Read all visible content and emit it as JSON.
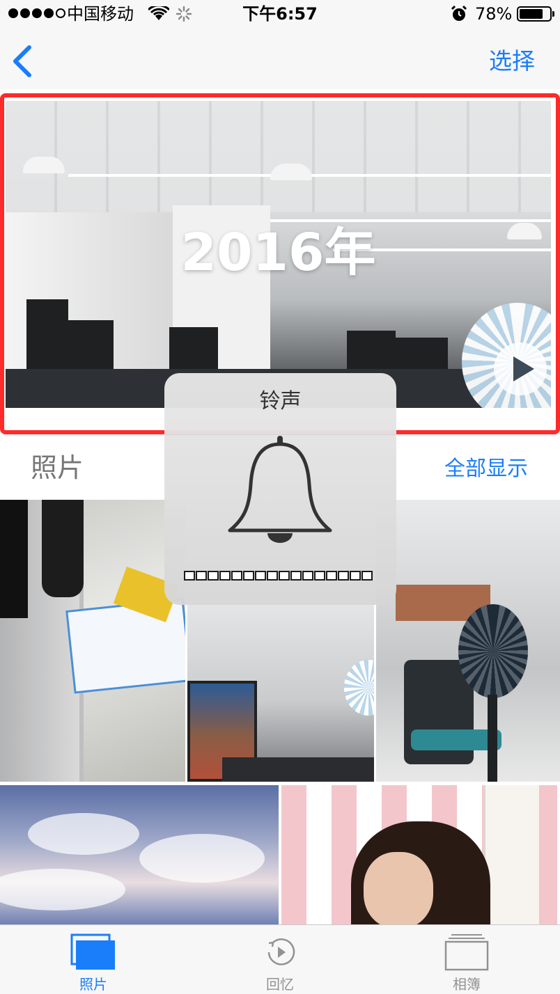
{
  "status_bar": {
    "signal_strength": 4,
    "signal_max": 5,
    "carrier": "中国移动",
    "time": "下午6:57",
    "battery_percent": "78%",
    "battery_level": 0.78,
    "icons": [
      "signal-dots-icon",
      "wifi-icon",
      "activity-spinner-icon",
      "alarm-clock-icon",
      "battery-icon"
    ]
  },
  "nav": {
    "back_icon": "chevron-left-icon",
    "select_label": "选择"
  },
  "memory": {
    "title": "2016年",
    "play_icon": "play-icon"
  },
  "photos_section": {
    "title": "照片",
    "show_all_label": "全部显示"
  },
  "volume_hud": {
    "title": "铃声",
    "icon": "bell-icon",
    "level": 0,
    "segments": 16
  },
  "tab_bar": {
    "tabs": [
      {
        "label": "照片",
        "icon": "photos-stack-icon",
        "active": true
      },
      {
        "label": "回忆",
        "icon": "memories-replay-icon",
        "active": false
      },
      {
        "label": "相簿",
        "icon": "albums-icon",
        "active": false
      }
    ]
  },
  "colors": {
    "accent": "#1a7dfa",
    "highlight_frame": "#ff2a2a",
    "inactive_tab": "#929292"
  }
}
